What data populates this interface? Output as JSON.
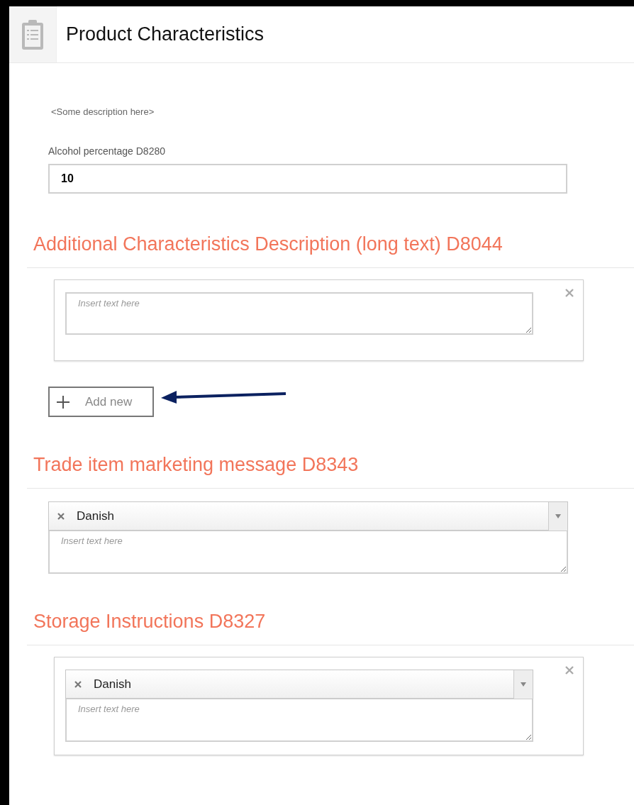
{
  "header": {
    "title": "Product Characteristics"
  },
  "description": "<Some description here>",
  "field": {
    "label": "Alcohol percentage D8280",
    "value": "10"
  },
  "sections": [
    {
      "title": "Additional Characteristics Description (long text) D8044",
      "kind": "card",
      "placeholder": "Insert text here",
      "add_button": "Add new"
    },
    {
      "title": "Trade item marketing message D8343",
      "kind": "plain",
      "language": "Danish",
      "placeholder": "Insert text here"
    },
    {
      "title": "Storage Instructions D8327",
      "kind": "card",
      "language": "Danish",
      "placeholder": "Insert text here"
    }
  ]
}
